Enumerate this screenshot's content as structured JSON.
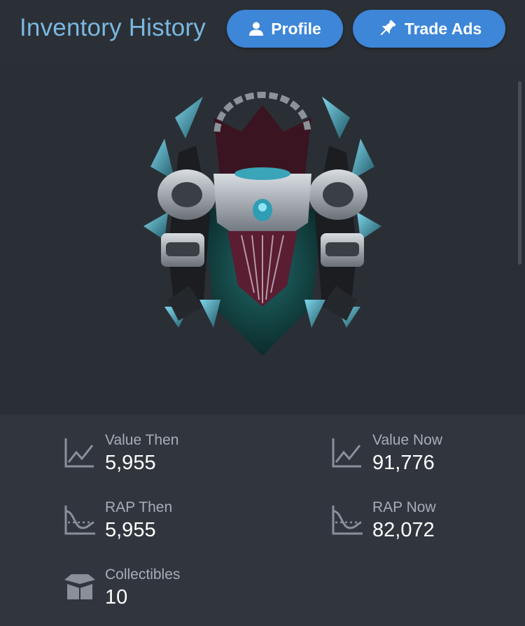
{
  "header": {
    "title": "Inventory History",
    "buttons": [
      {
        "label": "Profile",
        "icon": "user-icon"
      },
      {
        "label": "Trade Ads",
        "icon": "pin-icon"
      }
    ]
  },
  "item": {
    "image": "armored-spiked-shoulder-item"
  },
  "stats": [
    {
      "label": "Value Then",
      "value": "5,955",
      "icon": "line-chart-icon"
    },
    {
      "label": "Value Now",
      "value": "91,776",
      "icon": "line-chart-icon"
    },
    {
      "label": "RAP Then",
      "value": "5,955",
      "icon": "wave-chart-icon"
    },
    {
      "label": "RAP Now",
      "value": "82,072",
      "icon": "wave-chart-icon"
    },
    {
      "label": "Collectibles",
      "value": "10",
      "icon": "box-icon"
    }
  ],
  "colors": {
    "accent": "#3d86d8",
    "title": "#7ab8e0",
    "background": "#2a2f36",
    "panel": "#31363e"
  }
}
